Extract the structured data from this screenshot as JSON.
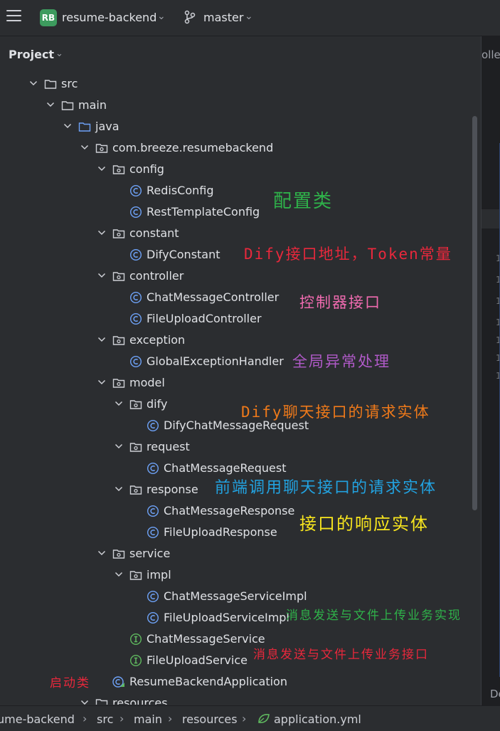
{
  "titlebar": {
    "project_badge": "RB",
    "project_name": "resume-backend",
    "branch": "master",
    "badge_color": "#3d9b5e"
  },
  "panel": {
    "title": "Project"
  },
  "editor": {
    "tab_fragment": "oller",
    "bottom_fragment": "De",
    "line_number_fragment": "1"
  },
  "tree": [
    {
      "label": "src",
      "type": "folder"
    },
    {
      "label": "main",
      "type": "folder"
    },
    {
      "label": "java",
      "type": "source-root"
    },
    {
      "label": "com.breeze.resumebackend",
      "type": "package"
    },
    {
      "label": "config",
      "type": "package"
    },
    {
      "label": "RedisConfig",
      "type": "class"
    },
    {
      "label": "RestTemplateConfig",
      "type": "class"
    },
    {
      "label": "constant",
      "type": "package"
    },
    {
      "label": "DifyConstant",
      "type": "class"
    },
    {
      "label": "controller",
      "type": "package"
    },
    {
      "label": "ChatMessageController",
      "type": "class"
    },
    {
      "label": "FileUploadController",
      "type": "class"
    },
    {
      "label": "exception",
      "type": "package"
    },
    {
      "label": "GlobalExceptionHandler",
      "type": "class"
    },
    {
      "label": "model",
      "type": "package"
    },
    {
      "label": "dify",
      "type": "package"
    },
    {
      "label": "DifyChatMessageRequest",
      "type": "class"
    },
    {
      "label": "request",
      "type": "package"
    },
    {
      "label": "ChatMessageRequest",
      "type": "class"
    },
    {
      "label": "response",
      "type": "package"
    },
    {
      "label": "ChatMessageResponse",
      "type": "class"
    },
    {
      "label": "FileUploadResponse",
      "type": "class"
    },
    {
      "label": "service",
      "type": "package"
    },
    {
      "label": "impl",
      "type": "package"
    },
    {
      "label": "ChatMessageServiceImpl",
      "type": "class"
    },
    {
      "label": "FileUploadServiceImpl",
      "type": "class"
    },
    {
      "label": "ChatMessageService",
      "type": "interface"
    },
    {
      "label": "FileUploadService",
      "type": "interface"
    },
    {
      "label": "ResumeBackendApplication",
      "type": "spring-app"
    },
    {
      "label": "resources",
      "type": "resources"
    }
  ],
  "annotations": [
    {
      "text": "配置类",
      "color": "#2fb24a"
    },
    {
      "text": "Dify接口地址，Token常量",
      "color": "#e8283c"
    },
    {
      "text": "控制器接口",
      "color": "#f06bb0"
    },
    {
      "text": "全局异常处理",
      "color": "#b05ac8"
    },
    {
      "text": "Dify聊天接口的请求实体",
      "color": "#f07a1a"
    },
    {
      "text": "前端调用聊天接口的请求实体",
      "color": "#22a2e0"
    },
    {
      "text": "接口的响应实体",
      "color": "#f7e51e"
    },
    {
      "text": "消息发送与文件上传业务实现",
      "color": "#2fb24a"
    },
    {
      "text": "消息发送与文件上传业务接口",
      "color": "#e8283c"
    },
    {
      "text": "启动类",
      "color": "#e8283c"
    }
  ],
  "statusbar": {
    "crumbs": [
      "ume-backend",
      "src",
      "main",
      "resources",
      "application.yml"
    ]
  },
  "icons": {
    "menu": "hamburger-icon",
    "branch": "git-branch-icon",
    "chevron": "chevron-icon",
    "folder": "folder-icon",
    "package": "package-icon",
    "class": "class-icon",
    "interface": "interface-icon",
    "spring": "spring-boot-icon",
    "yaml": "yaml-icon"
  }
}
